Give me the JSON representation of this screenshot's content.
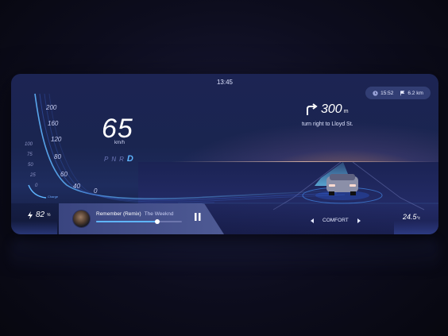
{
  "status": {
    "time": "13:45"
  },
  "trip": {
    "eta": "15:52",
    "remaining": "6.2 km"
  },
  "navigation": {
    "distance": "300",
    "unit": "m",
    "instruction": "turn right to Lloyd St."
  },
  "speedometer": {
    "speed": "65",
    "unit": "km/h",
    "gears": [
      "P",
      "N",
      "R"
    ],
    "active_gear": "D",
    "speed_ticks": [
      "200",
      "160",
      "120",
      "80",
      "60",
      "40",
      "0"
    ],
    "charge_ticks": [
      "100",
      "75",
      "50",
      "25",
      "0"
    ],
    "charge_label": "Charge"
  },
  "battery": {
    "value": "82",
    "unit": "%"
  },
  "media": {
    "title": "Remember (Remix)",
    "artist": "The Weeknd",
    "progress": 0.74
  },
  "drive_mode": {
    "label": "COMFORT"
  },
  "climate": {
    "temperature": "24.5",
    "unit": "°c"
  },
  "colors": {
    "accent": "#5fb5ff",
    "panel": "#1c2453"
  },
  "icons": [
    "clock-icon",
    "flag-icon",
    "turn-right-icon",
    "lightning-icon",
    "pause-icon",
    "chevron-left-icon",
    "chevron-right-icon"
  ]
}
